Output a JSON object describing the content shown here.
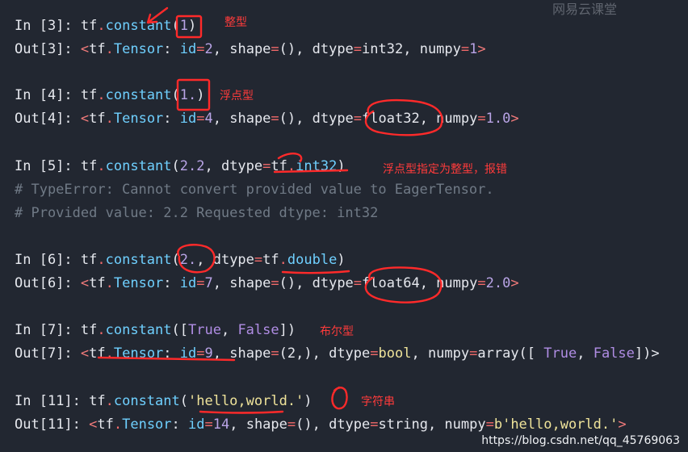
{
  "watermark_top": "网易云课堂",
  "watermark_bottom": "https://blog.csdn.net/qq_45769063",
  "lines": [
    {
      "prompt": "In [3]: ",
      "code": [
        [
          "tf",
          "val"
        ],
        [
          ".",
          "op"
        ],
        [
          "constant",
          "attr"
        ],
        [
          "(",
          "punc"
        ],
        [
          "1",
          "num"
        ],
        [
          ")",
          "punc"
        ]
      ]
    },
    {
      "prompt": "Out[3]: ",
      "code": [
        [
          "<",
          "angle"
        ],
        [
          "tf",
          "val"
        ],
        [
          ".",
          "op"
        ],
        [
          "Tensor",
          "attr"
        ],
        [
          ": ",
          "punc"
        ],
        [
          "id",
          "attr"
        ],
        [
          "=",
          "op"
        ],
        [
          "2",
          "num"
        ],
        [
          ", shape",
          "val"
        ],
        [
          "=",
          "op"
        ],
        [
          "(), dtype",
          "val"
        ],
        [
          "=",
          "op"
        ],
        [
          "int32",
          "val"
        ],
        [
          ", numpy",
          "val"
        ],
        [
          "=",
          "op"
        ],
        [
          "1",
          "num"
        ],
        [
          ">",
          "angle"
        ]
      ]
    },
    {
      "prompt": "In [4]: ",
      "code": [
        [
          "tf",
          "val"
        ],
        [
          ".",
          "op"
        ],
        [
          "constant",
          "attr"
        ],
        [
          "(",
          "punc"
        ],
        [
          "1.",
          "num"
        ],
        [
          ")",
          "punc"
        ]
      ]
    },
    {
      "prompt": "Out[4]: ",
      "code": [
        [
          "<",
          "angle"
        ],
        [
          "tf",
          "val"
        ],
        [
          ".",
          "op"
        ],
        [
          "Tensor",
          "attr"
        ],
        [
          ": ",
          "punc"
        ],
        [
          "id",
          "attr"
        ],
        [
          "=",
          "op"
        ],
        [
          "4",
          "num"
        ],
        [
          ", shape",
          "val"
        ],
        [
          "=",
          "op"
        ],
        [
          "(), dtype",
          "val"
        ],
        [
          "=",
          "op"
        ],
        [
          "float32",
          "val"
        ],
        [
          ", numpy",
          "val"
        ],
        [
          "=",
          "op"
        ],
        [
          "1.0",
          "num"
        ],
        [
          ">",
          "angle"
        ]
      ]
    },
    {
      "prompt": "In [5]: ",
      "code": [
        [
          "tf",
          "val"
        ],
        [
          ".",
          "op"
        ],
        [
          "constant",
          "attr"
        ],
        [
          "(",
          "punc"
        ],
        [
          "2.2",
          "num"
        ],
        [
          ", dtype",
          "val"
        ],
        [
          "=",
          "op"
        ],
        [
          "tf",
          "val"
        ],
        [
          ".",
          "op"
        ],
        [
          "int32",
          "attr"
        ],
        [
          ")",
          "punc"
        ]
      ]
    },
    {
      "prompt": "",
      "code": [
        [
          "# TypeError: Cannot convert provided value to EagerTensor.",
          "comment"
        ]
      ]
    },
    {
      "prompt": "",
      "code": [
        [
          "# Provided value: 2.2 Requested dtype: int32",
          "comment"
        ]
      ]
    },
    {
      "prompt": "In [6]: ",
      "code": [
        [
          "tf",
          "val"
        ],
        [
          ".",
          "op"
        ],
        [
          "constant",
          "attr"
        ],
        [
          "(",
          "punc"
        ],
        [
          "2.",
          "num"
        ],
        [
          ", dtype",
          "val"
        ],
        [
          "=",
          "op"
        ],
        [
          "tf",
          "val"
        ],
        [
          ".",
          "op"
        ],
        [
          "double",
          "attr"
        ],
        [
          ")",
          "punc"
        ]
      ]
    },
    {
      "prompt": "Out[6]: ",
      "code": [
        [
          "<",
          "angle"
        ],
        [
          "tf",
          "val"
        ],
        [
          ".",
          "op"
        ],
        [
          "Tensor",
          "attr"
        ],
        [
          ": ",
          "punc"
        ],
        [
          "id",
          "attr"
        ],
        [
          "=",
          "op"
        ],
        [
          "7",
          "num"
        ],
        [
          ", shape",
          "val"
        ],
        [
          "=",
          "op"
        ],
        [
          "(), dtype",
          "val"
        ],
        [
          "=",
          "op"
        ],
        [
          "float64",
          "val"
        ],
        [
          ", numpy",
          "val"
        ],
        [
          "=",
          "op"
        ],
        [
          "2.0",
          "num"
        ],
        [
          ">",
          "angle"
        ]
      ]
    },
    {
      "prompt": "In [7]: ",
      "code": [
        [
          "tf",
          "val"
        ],
        [
          ".",
          "op"
        ],
        [
          "constant",
          "attr"
        ],
        [
          "([",
          "punc"
        ],
        [
          "True",
          "bool"
        ],
        [
          ", ",
          "punc"
        ],
        [
          "False",
          "bool"
        ],
        [
          "])",
          "punc"
        ]
      ]
    },
    {
      "prompt": "Out[7]: ",
      "code": [
        [
          "<",
          "angle"
        ],
        [
          "tf",
          "val"
        ],
        [
          ".",
          "op"
        ],
        [
          "Tensor",
          "attr"
        ],
        [
          ": ",
          "punc"
        ],
        [
          "id",
          "attr"
        ],
        [
          "=",
          "op"
        ],
        [
          "9",
          "num"
        ],
        [
          ", shape",
          "val"
        ],
        [
          "=",
          "op"
        ],
        [
          "(2,), dtype",
          "val"
        ],
        [
          "=",
          "op"
        ],
        [
          "bool",
          "str"
        ],
        [
          ", numpy",
          "val"
        ],
        [
          "=",
          "op"
        ],
        [
          "array([ ",
          "val"
        ],
        [
          "True",
          "bool"
        ],
        [
          ", ",
          "punc"
        ],
        [
          "False",
          "bool"
        ],
        [
          "])>",
          "punc"
        ]
      ]
    },
    {
      "prompt": "In [11]: ",
      "code": [
        [
          "tf",
          "val"
        ],
        [
          ".",
          "op"
        ],
        [
          "constant",
          "attr"
        ],
        [
          "(",
          "punc"
        ],
        [
          "'hello,world.'",
          "str"
        ],
        [
          ")",
          "punc"
        ]
      ]
    },
    {
      "prompt": "Out[11]: ",
      "code": [
        [
          "<",
          "angle"
        ],
        [
          "tf",
          "val"
        ],
        [
          ".",
          "op"
        ],
        [
          "Tensor",
          "attr"
        ],
        [
          ": ",
          "punc"
        ],
        [
          "id",
          "attr"
        ],
        [
          "=",
          "op"
        ],
        [
          "14",
          "num"
        ],
        [
          ", shape",
          "val"
        ],
        [
          "=",
          "op"
        ],
        [
          "(), dtype",
          "val"
        ],
        [
          "=",
          "op"
        ],
        [
          "string",
          "val"
        ],
        [
          ", numpy",
          "val"
        ],
        [
          "=",
          "op"
        ],
        [
          "b'hello,world.'",
          "str"
        ],
        [
          ">",
          "angle"
        ]
      ]
    }
  ],
  "annotations": {
    "int": "整型",
    "float": "浮点型",
    "float_to_int_error": "浮点型指定为整型，报错",
    "bool": "布尔型",
    "string": "字符串"
  },
  "colors": {
    "background": "#222731",
    "annotation_red": "#ff3b3b"
  }
}
